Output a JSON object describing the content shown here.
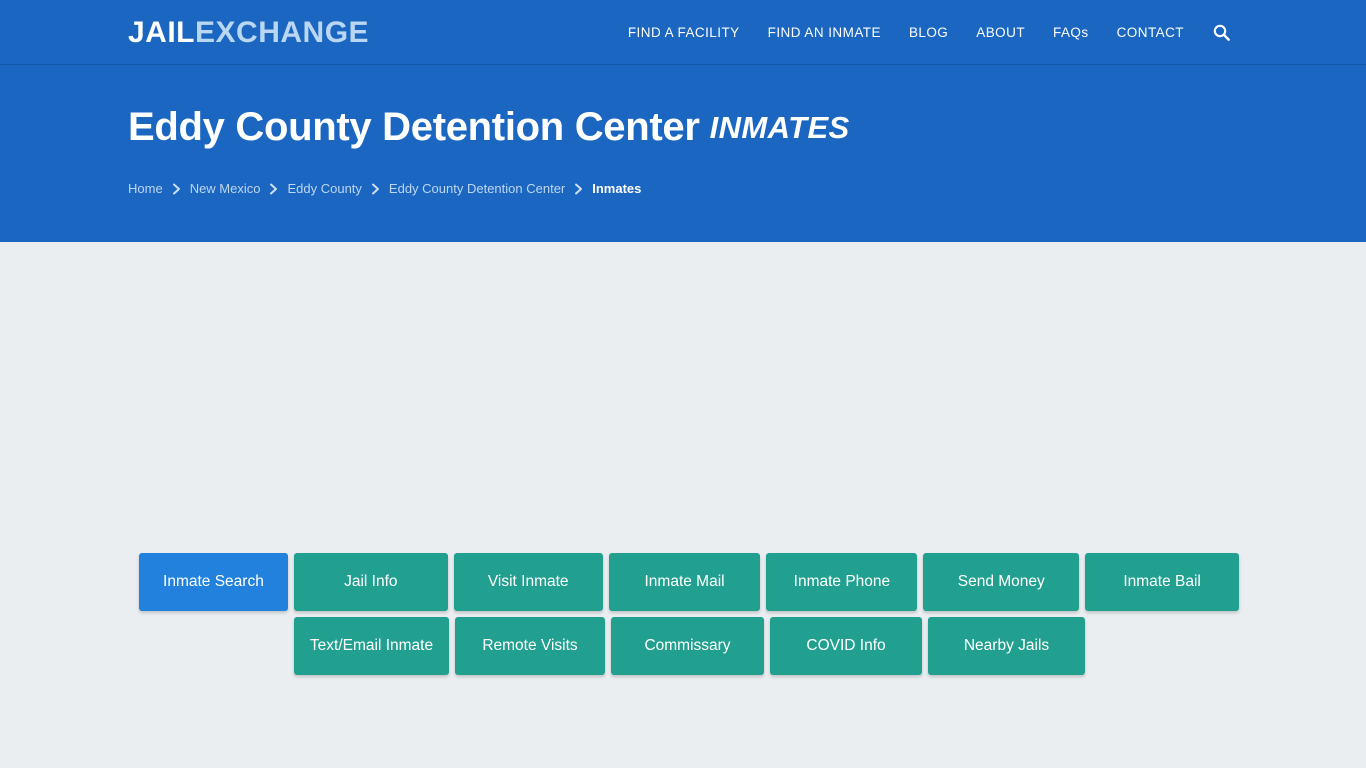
{
  "brand": {
    "part1": "JAIL",
    "part2": "EXCHANGE"
  },
  "nav": {
    "items": [
      {
        "label": "FIND A FACILITY",
        "name": "nav-find-a-facility"
      },
      {
        "label": "FIND AN INMATE",
        "name": "nav-find-an-inmate"
      },
      {
        "label": "BLOG",
        "name": "nav-blog"
      },
      {
        "label": "ABOUT",
        "name": "nav-about"
      },
      {
        "label": "FAQs",
        "name": "nav-faqs"
      },
      {
        "label": "CONTACT",
        "name": "nav-contact"
      }
    ],
    "search_icon": "search-icon"
  },
  "hero": {
    "title": "Eddy County Detention Center",
    "title_suffix": "INMATES"
  },
  "breadcrumb": {
    "items": [
      {
        "label": "Home",
        "current": false
      },
      {
        "label": "New Mexico",
        "current": false
      },
      {
        "label": "Eddy County",
        "current": false
      },
      {
        "label": "Eddy County Detention Center",
        "current": false
      },
      {
        "label": "Inmates",
        "current": true
      }
    ],
    "separator_icon": "chevron-right-icon"
  },
  "tabs": {
    "row1": [
      {
        "label": "Inmate Search",
        "active": true
      },
      {
        "label": "Jail Info",
        "active": false
      },
      {
        "label": "Visit Inmate",
        "active": false
      },
      {
        "label": "Inmate Mail",
        "active": false
      },
      {
        "label": "Inmate Phone",
        "active": false
      },
      {
        "label": "Send Money",
        "active": false
      },
      {
        "label": "Inmate Bail",
        "active": false
      }
    ],
    "row2": [
      {
        "label": "Text/Email Inmate",
        "active": false
      },
      {
        "label": "Remote Visits",
        "active": false
      },
      {
        "label": "Commissary",
        "active": false
      },
      {
        "label": "COVID Info",
        "active": false
      },
      {
        "label": "Nearby Jails",
        "active": false
      }
    ]
  },
  "colors": {
    "header_blue": "#1a66c0",
    "accent_teal": "#22a08f",
    "active_blue": "#2281dc",
    "page_background": "#eaeef1",
    "brand_light": "#b9d6f2"
  }
}
